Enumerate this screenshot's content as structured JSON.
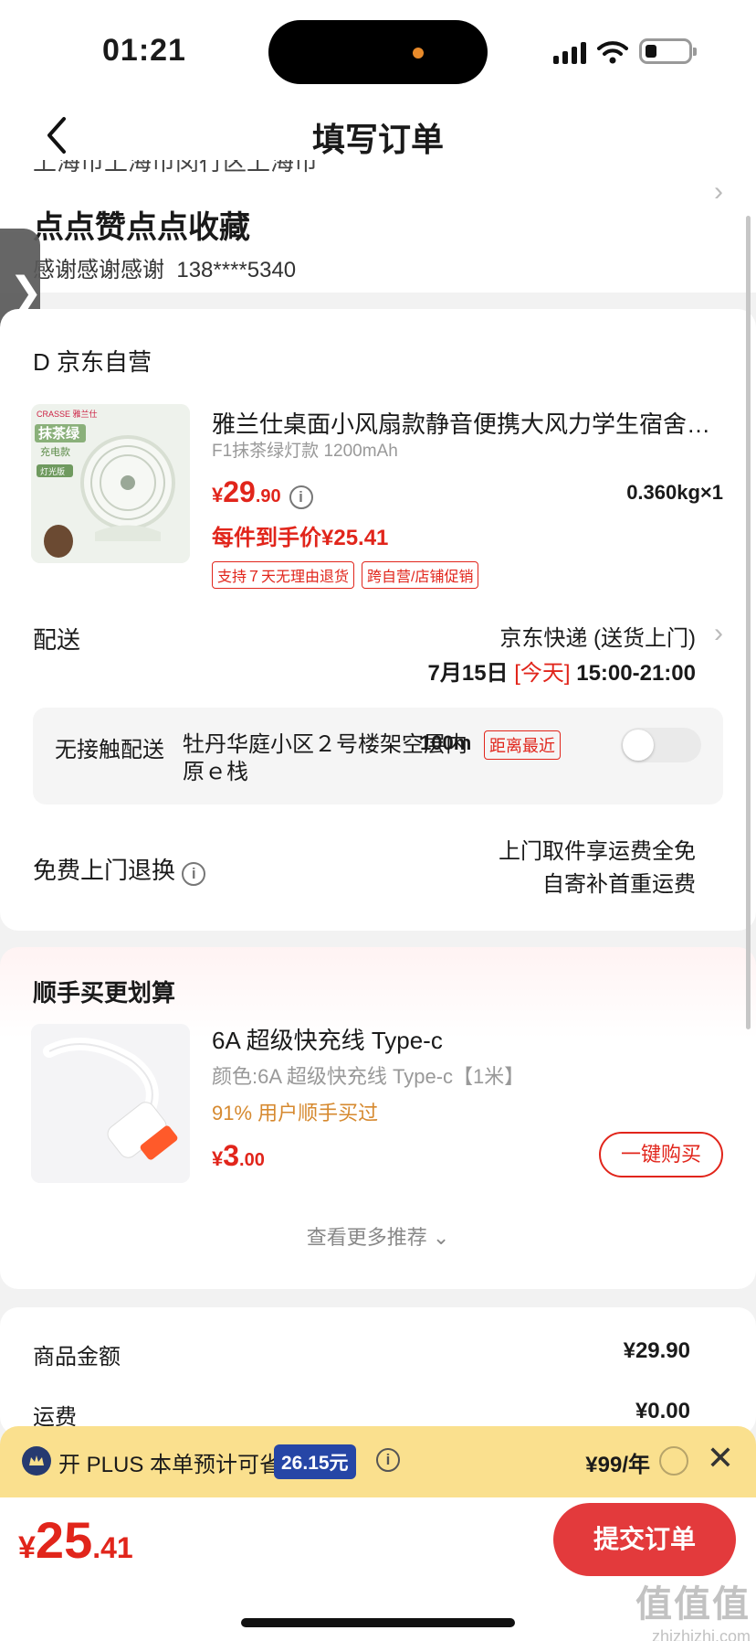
{
  "status": {
    "time": "01:21"
  },
  "nav": {
    "title": "填写订单"
  },
  "address": {
    "cut_line": "上海市上海市闵行区上海市",
    "name": "点点赞点点收藏",
    "contact": "感谢感谢感谢",
    "phone": "138****5340"
  },
  "order": {
    "shop": "京东自营",
    "product": {
      "title": "雅兰仕桌面小风扇款静音便携大风力学生宿舍床…",
      "spec": "F1抹茶绿灯款 1200mAh",
      "image_text": {
        "brand": "CRASSE 雅兰仕",
        "line1": "抹茶绿",
        "line2": "充电款",
        "line3": "灯光版"
      },
      "price_symbol": "¥",
      "price_int": "29",
      "price_dec": ".90",
      "weight": "0.360kg×1",
      "hand_price": "每件到手价¥25.41",
      "tags": [
        "支持７天无理由退货",
        "跨自营/店铺促销"
      ]
    },
    "delivery": {
      "label": "配送",
      "method": "京东快递 (送货上门)",
      "date": "7月15日",
      "today": "[今天]",
      "time": "15:00-21:00"
    },
    "contactless": {
      "label": "无接触配送",
      "location": "牡丹华庭小区２号楼架空层内原ｅ栈",
      "distance": "100m",
      "badge": "距离最近",
      "enabled": false
    },
    "returns": {
      "label": "免费上门退换",
      "line1": "上门取件享运费全免",
      "line2": "自寄补首重运费"
    }
  },
  "recommend": {
    "title": "顺手买更划算",
    "item": {
      "name": "6A 超级快充线 Type-c",
      "spec": "颜色:6A 超级快充线 Type-c【1米】",
      "social": "91% 用户顺手买过",
      "price_symbol": "¥",
      "price_int": "3",
      "price_dec": ".00",
      "button": "一键购买"
    },
    "more": "查看更多推荐"
  },
  "summary": {
    "rows": [
      {
        "label": "商品金额",
        "value": "¥29.90"
      },
      {
        "label": "运费",
        "value": "¥0.00"
      }
    ]
  },
  "plus": {
    "text": "开 PLUS 本单预计可省",
    "saving": "26.15元",
    "price": "¥99/年"
  },
  "bottom": {
    "total_symbol": "¥",
    "total_int": "25",
    "total_dec": ".41",
    "submit": "提交订单"
  },
  "watermark": {
    "big": "值值值",
    "small": "zhizhizhi.com"
  },
  "colors": {
    "accent": "#e1251b",
    "plus_bg": "#fae08e",
    "plus_badge": "#2646a6",
    "submit": "#e33a3c"
  }
}
